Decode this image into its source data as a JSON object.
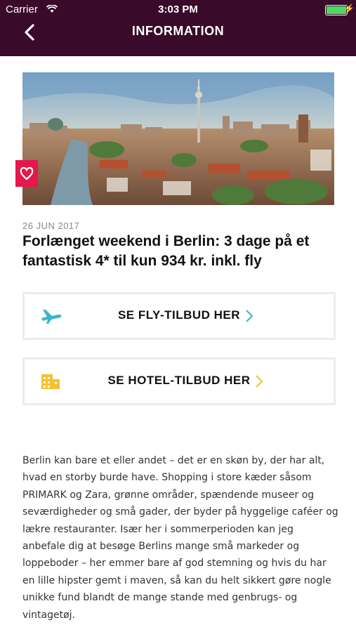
{
  "status_bar": {
    "carrier": "Carrier",
    "time": "3:03 PM"
  },
  "nav": {
    "title": "INFORMATION"
  },
  "article": {
    "date": "26 JUN 2017",
    "headline": "Forlænget weekend i Berlin: 3 dage på et fantastisk 4* til kun 934 kr. inkl. fly",
    "body": "Berlin kan bare et eller andet – det er en skøn by, der har alt, hvad en storby burde have. Shopping i store kæder såsom PRIMARK og Zara, grønne områder, spændende museer og seværdigheder og små gader, der byder på hyggelige caféer og lækre restauranter. Især her i sommerperioden kan jeg anbefale dig at besøge Berlins mange små markeder og loppeboder – her emmer bare af god stemning og hvis du har en lille hipster gemt i maven, så kan du helt sikkert gøre nogle unikke fund blandt de mange stande med genbrugs- og vintagetøj."
  },
  "buttons": {
    "fly_label": "SE FLY-TILBUD HER",
    "hotel_label": "SE HOTEL-TILBUD HER"
  },
  "colors": {
    "nav_bg": "#3a0a2a",
    "tag_red": "#e4184a",
    "fly_icon": "#3ab5c9",
    "hotel_icon": "#f2c230"
  },
  "icons": {
    "back": "chevron-left-icon",
    "wifi": "wifi-icon",
    "battery": "battery-icon",
    "tag": "heart-tag-icon",
    "fly": "airplane-icon",
    "hotel": "building-icon"
  }
}
